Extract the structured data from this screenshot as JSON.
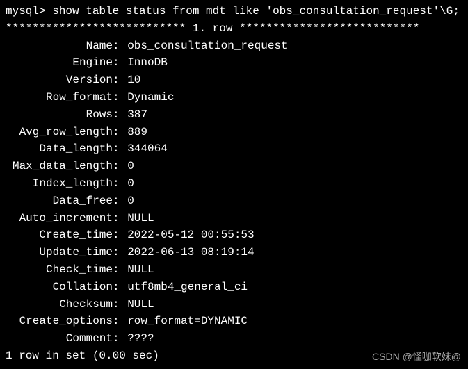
{
  "prompt": {
    "prefix": "mysql> ",
    "command": "show table status from mdt like 'obs_consultation_request'\\G;"
  },
  "separator": "*************************** 1. row ***************************",
  "fields": [
    {
      "label": "Name",
      "value": "obs_consultation_request"
    },
    {
      "label": "Engine",
      "value": "InnoDB"
    },
    {
      "label": "Version",
      "value": "10"
    },
    {
      "label": "Row_format",
      "value": "Dynamic"
    },
    {
      "label": "Rows",
      "value": "387"
    },
    {
      "label": "Avg_row_length",
      "value": "889"
    },
    {
      "label": "Data_length",
      "value": "344064"
    },
    {
      "label": "Max_data_length",
      "value": "0"
    },
    {
      "label": "Index_length",
      "value": "0"
    },
    {
      "label": "Data_free",
      "value": "0"
    },
    {
      "label": "Auto_increment",
      "value": "NULL"
    },
    {
      "label": "Create_time",
      "value": "2022-05-12 00:55:53"
    },
    {
      "label": "Update_time",
      "value": "2022-06-13 08:19:14"
    },
    {
      "label": "Check_time",
      "value": "NULL"
    },
    {
      "label": "Collation",
      "value": "utf8mb4_general_ci"
    },
    {
      "label": "Checksum",
      "value": "NULL"
    },
    {
      "label": "Create_options",
      "value": "row_format=DYNAMIC"
    },
    {
      "label": "Comment",
      "value": "????"
    }
  ],
  "footer": "1 row in set (0.00 sec)",
  "watermark": "CSDN @怪咖软妹@"
}
